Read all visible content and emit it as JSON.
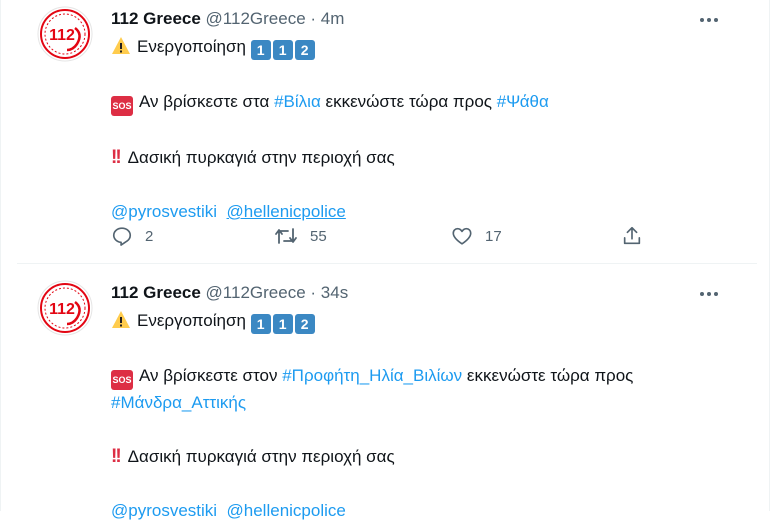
{
  "tweets": [
    {
      "name": "112 Greece",
      "handle": "@112Greece",
      "sep": "·",
      "time": "4m",
      "activation": "Ενεργοποίηση",
      "keycaps": [
        "1",
        "1",
        "2"
      ],
      "sos_label": "SOS",
      "line2": {
        "pre": "Αν βρίσκεστε στα ",
        "tag1": "#Βίλια",
        "mid": " εκκενώστε τώρα προς ",
        "tag2": "#Ψάθα"
      },
      "warning": "Δασική πυρκαγιά στην περιοχή σας",
      "mention1": "@pyrosvestiki",
      "mention2": "@hellenicpolice",
      "replies": "2",
      "retweets": "55",
      "likes": "17"
    },
    {
      "name": "112 Greece",
      "handle": "@112Greece",
      "sep": "·",
      "time": "34s",
      "activation": "Ενεργοποίηση",
      "keycaps": [
        "1",
        "1",
        "2"
      ],
      "sos_label": "SOS",
      "line2": {
        "pre": "Αν βρίσκεστε στον ",
        "tag1": "#Προφήτη_Ηλία_Βιλίων",
        "mid": " εκκενώστε τώρα προς ",
        "tag2": "#Μάνδρα_Αττικής"
      },
      "warning": "Δασική πυρκαγιά στην περιοχή σας",
      "mention1": "@pyrosvestiki",
      "mention2": "@hellenicpolice"
    }
  ],
  "avatar_text": "112",
  "colors": {
    "link": "#1d9bf0",
    "muted": "#536471",
    "keycap": "#3b88c3",
    "sos": "#dd2e44",
    "avatar_red": "#e30613"
  },
  "icons": [
    "warning-icon",
    "sos-icon",
    "double-exclamation-icon",
    "reply-icon",
    "retweet-icon",
    "like-icon",
    "share-icon",
    "more-icon"
  ]
}
